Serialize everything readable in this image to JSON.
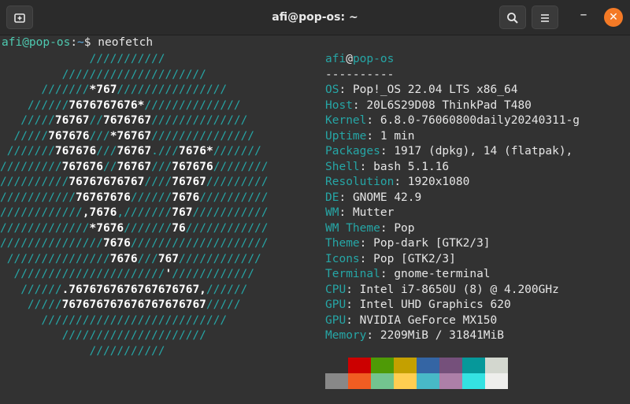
{
  "window": {
    "title": "afi@pop-os: ~",
    "new_tab_icon": "new-tab-icon",
    "search_icon": "search-icon",
    "menu_icon": "hamburger-menu-icon",
    "minimize_glyph": "–",
    "close_glyph": "✕"
  },
  "prompt": {
    "user": "afi@pop-os",
    "sep": ":",
    "path": "~",
    "dollar": "$ ",
    "command": "neofetch"
  },
  "art": [
    [
      [
        "a",
        "             ///////////"
      ]
    ],
    [
      [
        "a",
        "         /////////////////////"
      ]
    ],
    [
      [
        "a",
        "      ///////"
      ],
      [
        "b",
        "*767"
      ],
      [
        "a",
        "////////////////"
      ]
    ],
    [
      [
        "a",
        "    //////"
      ],
      [
        "b",
        "7676767676*"
      ],
      [
        "a",
        "//////////////"
      ]
    ],
    [
      [
        "a",
        "   /////"
      ],
      [
        "b",
        "76767"
      ],
      [
        "a",
        "//"
      ],
      [
        "b",
        "7676767"
      ],
      [
        "a",
        "//////////////"
      ]
    ],
    [
      [
        "a",
        "  /////"
      ],
      [
        "b",
        "767676"
      ],
      [
        "a",
        "///"
      ],
      [
        "b",
        "*76767"
      ],
      [
        "a",
        "///////////////"
      ]
    ],
    [
      [
        "a",
        " ///////"
      ],
      [
        "b",
        "767676"
      ],
      [
        "a",
        "///"
      ],
      [
        "b",
        "76767"
      ],
      [
        "a",
        "."
      ],
      [
        "a",
        "///"
      ],
      [
        "b",
        "7676*"
      ],
      [
        "a",
        "///////"
      ]
    ],
    [
      [
        "a",
        "/////////"
      ],
      [
        "b",
        "767676"
      ],
      [
        "a",
        "//"
      ],
      [
        "b",
        "76767"
      ],
      [
        "a",
        "///"
      ],
      [
        "b",
        "767676"
      ],
      [
        "a",
        "////////"
      ]
    ],
    [
      [
        "a",
        "//////////"
      ],
      [
        "b",
        "76767676767"
      ],
      [
        "a",
        "////"
      ],
      [
        "b",
        "76767"
      ],
      [
        "a",
        "/////////"
      ]
    ],
    [
      [
        "a",
        "///////////"
      ],
      [
        "b",
        "76767676"
      ],
      [
        "a",
        "//////"
      ],
      [
        "b",
        "7676"
      ],
      [
        "a",
        "//////////"
      ]
    ],
    [
      [
        "a",
        "////////////"
      ],
      [
        "b",
        ",7676"
      ],
      [
        "a",
        ","
      ],
      [
        "a",
        "///////"
      ],
      [
        "b",
        "767"
      ],
      [
        "a",
        "///////////"
      ]
    ],
    [
      [
        "a",
        "/////////////"
      ],
      [
        "b",
        "*7676"
      ],
      [
        "a",
        "///////"
      ],
      [
        "b",
        "76"
      ],
      [
        "a",
        "////////////"
      ]
    ],
    [
      [
        "a",
        "///////////////"
      ],
      [
        "b",
        "7676"
      ],
      [
        "a",
        "////////////////////"
      ]
    ],
    [
      [
        "a",
        " ///////////////"
      ],
      [
        "b",
        "7676"
      ],
      [
        "a",
        "///"
      ],
      [
        "b",
        "767"
      ],
      [
        "a",
        "////////////"
      ]
    ],
    [
      [
        "a",
        "  //////////////////////"
      ],
      [
        "b",
        "'"
      ],
      [
        "a",
        "////////////"
      ]
    ],
    [
      [
        "a",
        "   //////"
      ],
      [
        "b",
        ".7676767676767676767,"
      ],
      [
        "a",
        "//////"
      ]
    ],
    [
      [
        "a",
        "    /////"
      ],
      [
        "b",
        "767676767676767676767"
      ],
      [
        "a",
        "/////"
      ]
    ],
    [
      [
        "a",
        "      ///////////////////////////"
      ]
    ],
    [
      [
        "a",
        "         /////////////////////"
      ]
    ],
    [
      [
        "a",
        "             ///////////"
      ]
    ]
  ],
  "info": {
    "user": "afi",
    "at": "@",
    "host": "pop-os",
    "rule": "----------",
    "rows": [
      {
        "k": "OS",
        "v": "Pop!_OS 22.04 LTS x86_64"
      },
      {
        "k": "Host",
        "v": "20L6S29D08 ThinkPad T480"
      },
      {
        "k": "Kernel",
        "v": "6.8.0-76060800daily20240311-g"
      },
      {
        "k": "Uptime",
        "v": "1 min"
      },
      {
        "k": "Packages",
        "v": "1917 (dpkg), 14 (flatpak),"
      },
      {
        "k": "Shell",
        "v": "bash 5.1.16"
      },
      {
        "k": "Resolution",
        "v": "1920x1080"
      },
      {
        "k": "DE",
        "v": "GNOME 42.9"
      },
      {
        "k": "WM",
        "v": "Mutter"
      },
      {
        "k": "WM Theme",
        "v": "Pop"
      },
      {
        "k": "Theme",
        "v": "Pop-dark [GTK2/3]"
      },
      {
        "k": "Icons",
        "v": "Pop [GTK2/3]"
      },
      {
        "k": "Terminal",
        "v": "gnome-terminal"
      },
      {
        "k": "CPU",
        "v": "Intel i7-8650U (8) @ 4.200GHz"
      },
      {
        "k": "GPU",
        "v": "Intel UHD Graphics 620"
      },
      {
        "k": "GPU",
        "v": "NVIDIA GeForce MX150"
      },
      {
        "k": "Memory",
        "v": "2209MiB / 31841MiB"
      }
    ],
    "sep": ": "
  },
  "palette": {
    "row1": [
      "#323232",
      "#cc0000",
      "#4e9a06",
      "#c4a000",
      "#3465a4",
      "#75507b",
      "#06989a",
      "#d3d7cf"
    ],
    "row2": [
      "#888888",
      "#f15d22",
      "#73c48f",
      "#ffce51",
      "#48b9c7",
      "#ad7fa8",
      "#34e2e2",
      "#eeeeec"
    ]
  }
}
